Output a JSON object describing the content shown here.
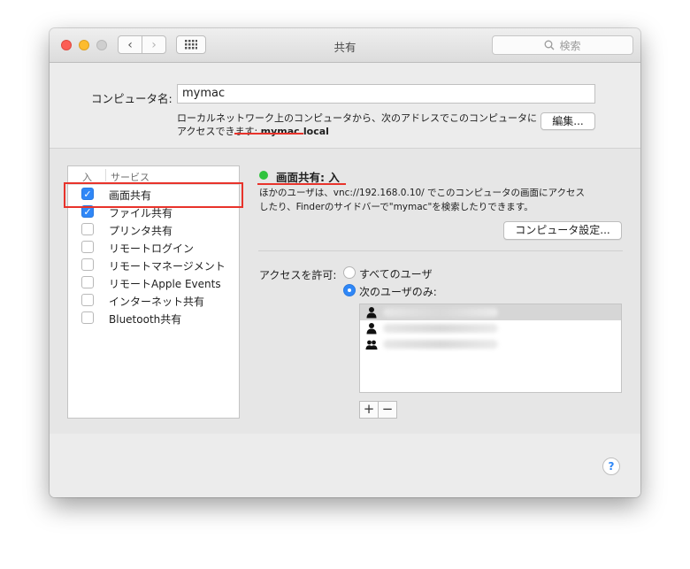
{
  "window": {
    "title": "共有"
  },
  "toolbar": {
    "back_icon": "‹",
    "forward_icon": "›",
    "grid_icon": "⋮⋮⋮",
    "search_placeholder": "検索"
  },
  "computer_name": {
    "label": "コンピュータ名:",
    "value": "mymac",
    "address_text": "ローカルネットワーク上のコンピュータから、次のアドレスでこのコンピュータにアクセスできます:",
    "hostname": "mymac.local",
    "edit_button": "編集..."
  },
  "services": {
    "header_on": "入",
    "header_service": "サービス",
    "items": [
      {
        "label": "画面共有",
        "checked": true
      },
      {
        "label": "ファイル共有",
        "checked": true
      },
      {
        "label": "プリンタ共有",
        "checked": false
      },
      {
        "label": "リモートログイン",
        "checked": false
      },
      {
        "label": "リモートマネージメント",
        "checked": false
      },
      {
        "label": "リモートApple Events",
        "checked": false
      },
      {
        "label": "インターネット共有",
        "checked": false
      },
      {
        "label": "Bluetooth共有",
        "checked": false
      }
    ]
  },
  "detail": {
    "status_title": "画面共有: 入",
    "status_color": "#2fc33d",
    "description": "ほかのユーザは、vnc://192.168.0.10/ でこのコンピュータの画面にアクセスしたり、Finderのサイドバーで\"mymac\"を検索したりできます。",
    "computer_settings_button": "コンピュータ設定...",
    "access_label": "アクセスを許可:",
    "radio_all": "すべてのユーザ",
    "radio_only": "次のユーザのみ:",
    "user_icons": [
      "user-icon",
      "user-icon",
      "group-icon"
    ],
    "add_button": "+",
    "remove_button": "−"
  },
  "help_button": "?",
  "colors": {
    "accent": "#2f87f7",
    "annotation_red": "#e8332b"
  }
}
